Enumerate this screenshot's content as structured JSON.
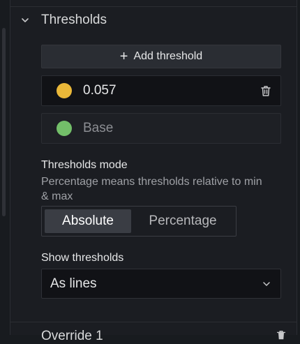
{
  "section": {
    "title": "Thresholds",
    "add_label": "Add threshold"
  },
  "thresholds": [
    {
      "value": "0.057",
      "color": "#eab839"
    },
    {
      "value": "Base",
      "color": "#73bf69"
    }
  ],
  "mode": {
    "label": "Thresholds mode",
    "description": "Percentage means thresholds relative to min & max",
    "options": [
      "Absolute",
      "Percentage"
    ],
    "selected": "Absolute"
  },
  "show": {
    "label": "Show thresholds",
    "value": "As lines"
  },
  "override": {
    "title": "Override 1"
  },
  "icons": {
    "collapse": "chevron-down-icon",
    "add": "plus-icon",
    "delete": "trash-icon",
    "select": "chevron-down-icon"
  }
}
